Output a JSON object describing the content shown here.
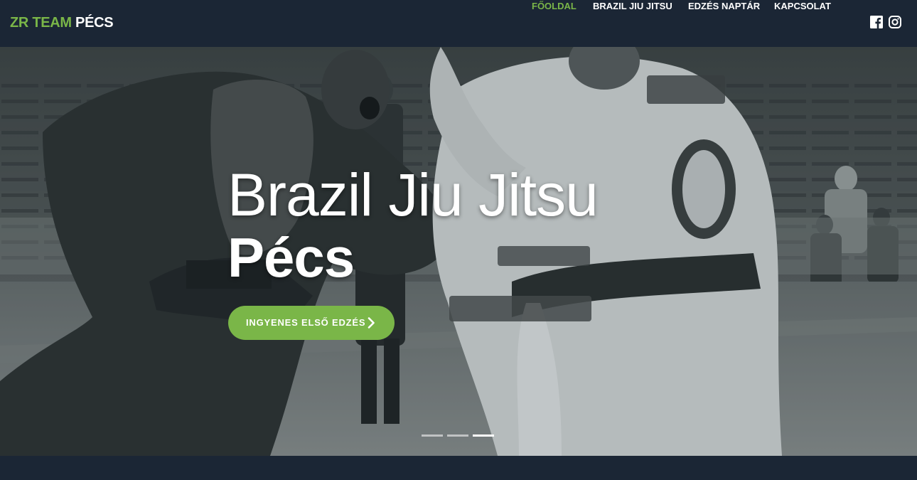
{
  "brand": {
    "part1": "ZR TEAM",
    "part2": "PÉCS"
  },
  "nav": {
    "items": [
      {
        "label": "FŐOLDAL",
        "active": true
      },
      {
        "label": "BRAZIL JIU JITSU",
        "active": false
      },
      {
        "label": "EDZÉS NAPTÁR",
        "active": false
      },
      {
        "label": "KAPCSOLAT",
        "active": false
      }
    ],
    "social": [
      "facebook-icon",
      "instagram-icon"
    ]
  },
  "hero": {
    "title_line1": "Brazil Jiu Jitsu",
    "title_line2": "Pécs",
    "cta_label": "INGYENES ELSŐ EDZÉS",
    "slides_total": 3,
    "active_slide": 3
  },
  "colors": {
    "accent": "#7ab648",
    "navbar_bg": "#1b2635",
    "text": "#ffffff"
  }
}
